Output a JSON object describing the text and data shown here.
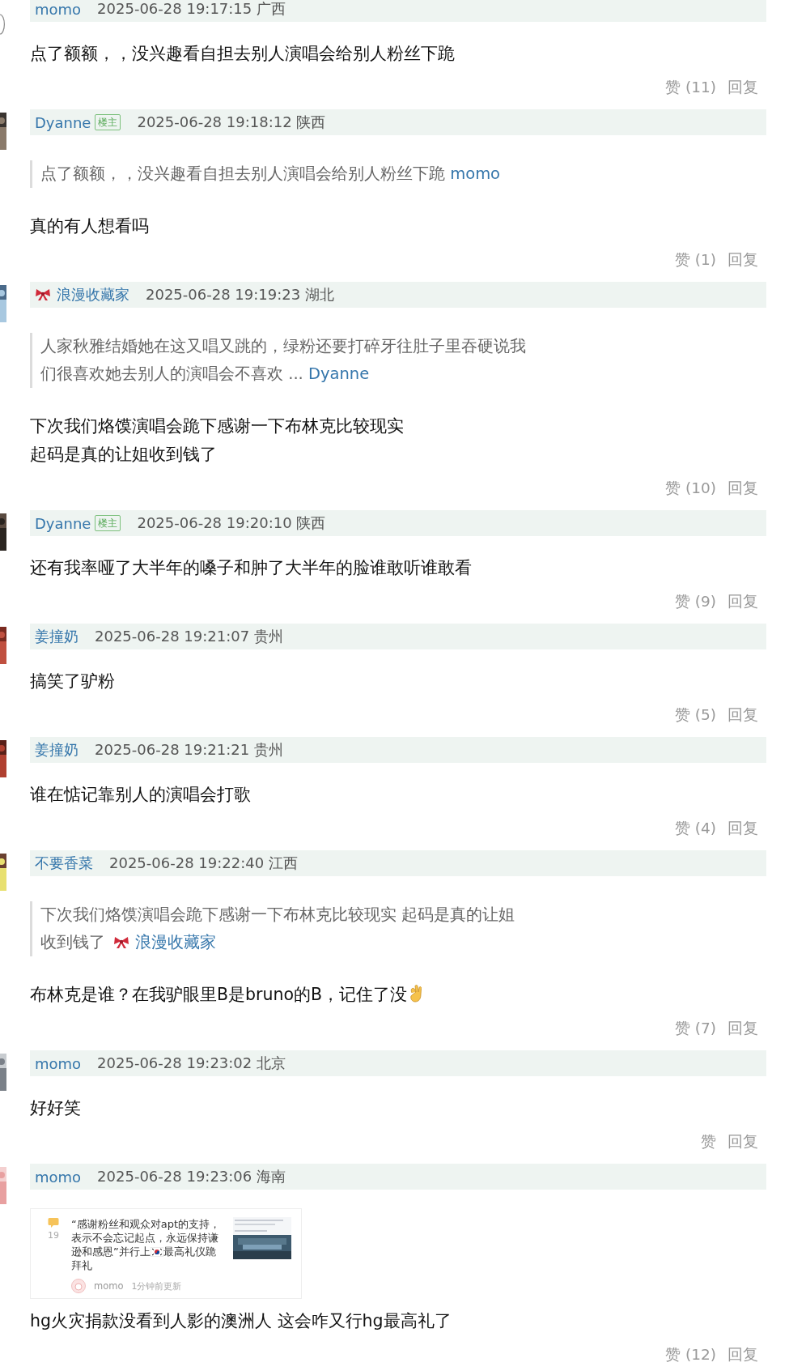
{
  "comments": [
    {
      "author": "momo",
      "bow": false,
      "time": "2025-06-28 19:17:15",
      "location": "广西",
      "body": [
        "点了额额，，没兴趣看自担去别人演唱会给别人粉丝下跪"
      ],
      "emoji_end": false,
      "like": "赞 (11)",
      "reply": "回复"
    },
    {
      "author": "Dyanne",
      "badge": "楼主",
      "bow": false,
      "time": "2025-06-28 19:18:12",
      "location": "陕西",
      "quote": {
        "lines": [
          "点了额额，，没兴趣看自担去别人演唱会给别人粉丝下跪"
        ],
        "author": "momo",
        "bow": false
      },
      "body": [
        "真的有人想看吗"
      ],
      "emoji_end": false,
      "like": "赞 (1)",
      "reply": "回复"
    },
    {
      "author": "浪漫收藏家",
      "bow": true,
      "time": "2025-06-28 19:19:23",
      "location": "湖北",
      "quote": {
        "lines": [
          "人家秋雅结婚她在这又唱又跳的，绿粉还要打碎牙往肚子里吞硬说我",
          "们很喜欢她去别人的演唱会不喜欢 ..."
        ],
        "author": "Dyanne",
        "bow": false
      },
      "body": [
        "下次我们烙馍演唱会跪下感谢一下布林克比较现实",
        "起码是真的让姐收到钱了"
      ],
      "emoji_end": false,
      "like": "赞 (10)",
      "reply": "回复"
    },
    {
      "author": "Dyanne",
      "badge": "楼主",
      "bow": false,
      "time": "2025-06-28 19:20:10",
      "location": "陕西",
      "body": [
        "还有我率哑了大半年的嗓子和肿了大半年的脸谁敢听谁敢看"
      ],
      "emoji_end": false,
      "like": "赞 (9)",
      "reply": "回复"
    },
    {
      "author": "姜撞奶",
      "bow": false,
      "time": "2025-06-28 19:21:07",
      "location": "贵州",
      "body": [
        "搞笑了驴粉"
      ],
      "emoji_end": false,
      "like": "赞 (5)",
      "reply": "回复"
    },
    {
      "author": "姜撞奶",
      "bow": false,
      "time": "2025-06-28 19:21:21",
      "location": "贵州",
      "body": [
        "谁在惦记靠别人的演唱会打歌"
      ],
      "emoji_end": false,
      "like": "赞 (4)",
      "reply": "回复"
    },
    {
      "author": "不要香菜",
      "bow": false,
      "time": "2025-06-28 19:22:40",
      "location": "江西",
      "quote": {
        "lines": [
          "下次我们烙馍演唱会跪下感谢一下布林克比较现实 起码是真的让姐",
          "收到钱了"
        ],
        "author": "浪漫收藏家",
        "bow": true
      },
      "body": [
        "布林克是谁？在我驴眼里B是bruno的B，记住了没"
      ],
      "emoji_end": true,
      "like": "赞 (7)",
      "reply": "回复"
    },
    {
      "author": "momo",
      "bow": false,
      "time": "2025-06-28 19:23:02",
      "location": "北京",
      "body": [
        "好好笑"
      ],
      "emoji_end": false,
      "like": "赞",
      "reply": "回复"
    },
    {
      "author": "momo",
      "bow": false,
      "time": "2025-06-28 19:23:06",
      "location": "海南",
      "card": {
        "count": "19",
        "title_before_flag": "“感谢粉丝和观众对apt的支持，表示不会忘记起点，永远保持谦逊和感恩”并行上",
        "title_after_flag": "最高礼仪跪拜礼",
        "author": "momo",
        "updated": "1分钟前更新"
      },
      "body": [
        "hg火灾捐款没看到人影的澳洲人 这会咋又行hg最高礼了"
      ],
      "emoji_end": false,
      "like": "赞 (12)",
      "reply": "回复"
    }
  ]
}
